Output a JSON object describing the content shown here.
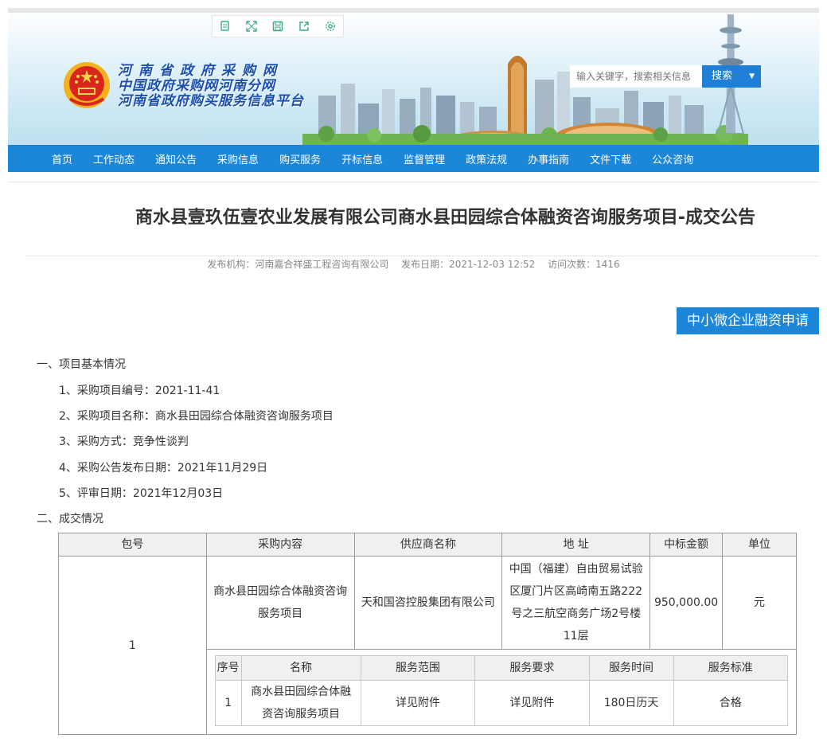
{
  "toolbar": {
    "icons": [
      "copy-icon",
      "fullscreen-icon",
      "save-icon",
      "share-icon",
      "settings-icon"
    ]
  },
  "site": {
    "title_line1": "河南省政府采购网",
    "title_line2": "中国政府采购网河南分网",
    "title_line3": "河南省政府购买服务信息平台"
  },
  "search": {
    "placeholder": "输入关键字，搜索相关信息",
    "button_label": "搜索",
    "caret": "▼"
  },
  "nav": {
    "items": [
      "首页",
      "工作动态",
      "通知公告",
      "采购信息",
      "购买服务",
      "开标信息",
      "监督管理",
      "政策法规",
      "办事指南",
      "文件下载",
      "公众咨询"
    ]
  },
  "article": {
    "title": "商水县壹玖伍壹农业发展有限公司商水县田园综合体融资咨询服务项目-成交公告",
    "publisher": "发布机构：河南嘉合祥盛工程咨询有限公司",
    "publish_date": "发布日期：2021-12-03 12:52",
    "visits": "访问次数：1416",
    "finance_button": "中小微企业融资申请",
    "section1": "一、项目基本情况",
    "items": [
      "1、采购项目编号：2021-11-41",
      "2、采购项目名称：商水县田园综合体融资咨询服务项目",
      "3、采购方式：竞争性谈判",
      "4、采购公告发布日期：2021年11月29日",
      "5、评审日期：2021年12月03日"
    ],
    "section2": "二、成交情况"
  },
  "deal_table": {
    "headers": [
      "包号",
      "采购内容",
      "供应商名称",
      "地 址",
      "中标金额",
      "单位"
    ],
    "row": {
      "package": "1",
      "content_line1": "商水县田园综合体融资咨询",
      "content_line2": "服务项目",
      "supplier": "天和国咨控股集团有限公司",
      "address_lines": [
        "中国（福建）自由贸易试验",
        "区厦门片区高崎南五路222",
        "号之三航空商务广场2号楼",
        "11层"
      ],
      "amount": "950,000.00",
      "unit": "元"
    }
  },
  "service_table": {
    "headers": [
      "序号",
      "名称",
      "服务范围",
      "服务要求",
      "服务时间",
      "服务标准"
    ],
    "row": {
      "no": "1",
      "name_line1": "商水县田园综合体融",
      "name_line2": "资咨询服务项目",
      "scope": "详见附件",
      "requirement": "详见附件",
      "time": "180日历天",
      "standard": "合格"
    }
  }
}
